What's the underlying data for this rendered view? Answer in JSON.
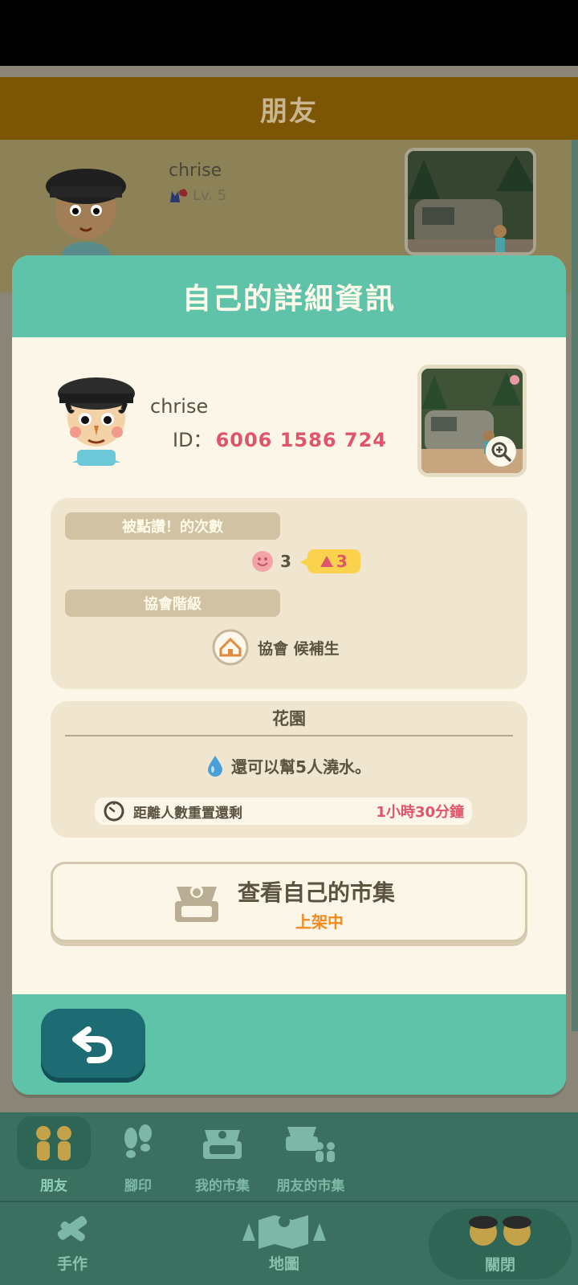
{
  "background": {
    "header_title": "朋友",
    "friend_name": "chrise",
    "friend_level": "Lv. 5"
  },
  "modal": {
    "title": "自己的詳細資訊",
    "profile": {
      "name": "chrise",
      "id_label": "ID：",
      "id_value": "6006 1586 724"
    },
    "likes": {
      "section_label": "被點讚！的次數",
      "count": "3",
      "badge_count": "3"
    },
    "rank": {
      "section_label": "協會階級",
      "value": "協會 候補生"
    },
    "garden": {
      "title": "花園",
      "water_text": "還可以幫5人澆水。",
      "reset_label": "距離人數重置還剩",
      "reset_value": "1小時30分鐘"
    },
    "market": {
      "title": "查看自己的市集",
      "status": "上架中"
    }
  },
  "subnav": [
    {
      "label": "朋友",
      "icon": "friends-icon",
      "active": true
    },
    {
      "label": "腳印",
      "icon": "footprint-icon",
      "active": false
    },
    {
      "label": "我的市集",
      "icon": "my-market-icon",
      "active": false
    },
    {
      "label": "朋友的市集",
      "icon": "friends-market-icon",
      "active": false
    }
  ],
  "mainnav": [
    {
      "label": "手作",
      "icon": "craft-icon"
    },
    {
      "label": "地圖",
      "icon": "map-icon"
    },
    {
      "label": "關閉",
      "icon": "close-people-icon"
    }
  ],
  "colors": {
    "teal": "#5fc3aa",
    "accent_red": "#e0556b",
    "orange": "#f08a1f",
    "back_button": "#1d6c73"
  }
}
